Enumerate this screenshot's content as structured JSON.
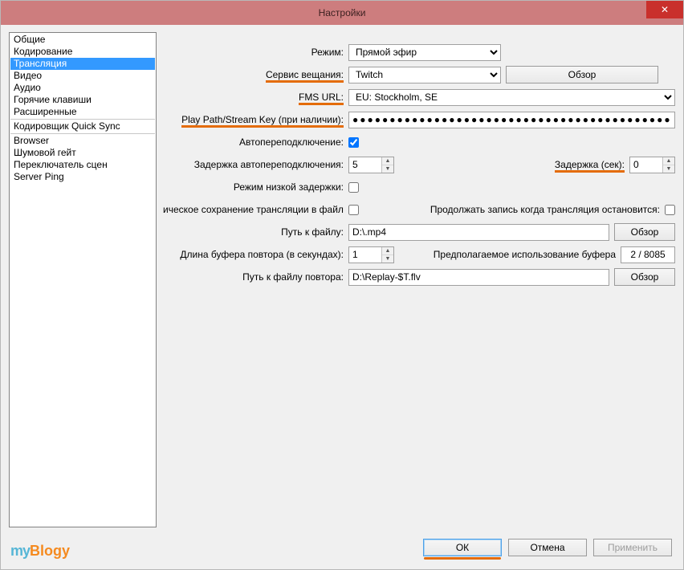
{
  "window": {
    "title": "Настройки"
  },
  "sidebar": {
    "items_top": [
      "Общие",
      "Кодирование",
      "Трансляция",
      "Видео",
      "Аудио",
      "Горячие клавиши",
      "Расширенные"
    ],
    "selected_index": 2,
    "items_mid": [
      "Кодировщик Quick Sync"
    ],
    "items_bottom": [
      "Browser",
      "Шумовой гейт",
      "Переключатель сцен",
      "Server Ping"
    ]
  },
  "panel": {
    "mode": {
      "label": "Режим:",
      "value": "Прямой эфир"
    },
    "service": {
      "label": "Сервис вещания:",
      "value": "Twitch",
      "browse": "Обзор"
    },
    "fms": {
      "label": "FMS URL:",
      "value": "EU: Stockholm, SE"
    },
    "playpath": {
      "label": "Play Path/Stream Key (при наличии):",
      "value": "●●●●●●●●●●●●●●●●●●●●●●●●●●●●●●●●●●●●●●●●●●●●"
    },
    "autoreconnect": {
      "label": "Автопереподключение:"
    },
    "reconnect_delay": {
      "label": "Задержка автопереподключения:",
      "value": "5"
    },
    "delay": {
      "label": "Задержка (сек):",
      "value": "0"
    },
    "low_latency": {
      "label": "Режим низкой задержки:"
    },
    "save_stream": {
      "label": "ическое сохранение трансляции в файл:"
    },
    "keep_record": {
      "label": "Продолжать запись когда трансляция остановится:"
    },
    "file_path": {
      "label": "Путь к файлу:",
      "value": "D:\\.mp4",
      "browse": "Обзор"
    },
    "replay_buffer": {
      "label": "Длина буфера повтора (в секундах):",
      "value": "1"
    },
    "buffer_use": {
      "label": "Предполагаемое использование буфера",
      "value": "2 / 8085"
    },
    "replay_path": {
      "label": "Путь к файлу повтора:",
      "value": "D:\\Replay-$T.flv",
      "browse": "Обзор"
    }
  },
  "footer": {
    "ok": "ОК",
    "cancel": "Отмена",
    "apply": "Применить"
  },
  "logo": {
    "my": "my",
    "blogy": "Blogy"
  }
}
